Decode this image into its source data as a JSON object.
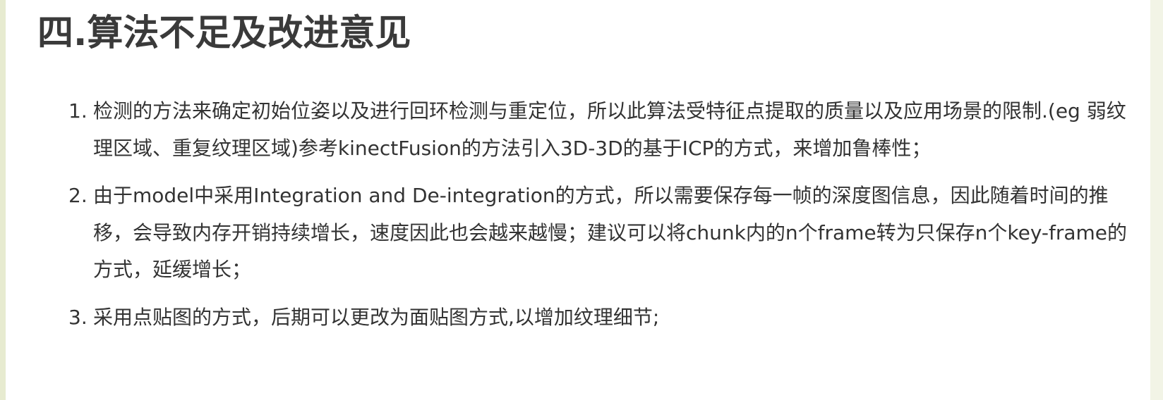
{
  "section": {
    "title": "四.算法不足及改进意见"
  },
  "list": {
    "items": [
      {
        "number": "1.",
        "text": "检测的方法来确定初始位姿以及进行回环检测与重定位，所以此算法受特征点提取的质量以及应用场景的限制.(eg 弱纹理区域、重复纹理区域)参考kinectFusion的方法引入3D-3D的基于ICP的方式，来增加鲁棒性；"
      },
      {
        "number": "2.",
        "text": "由于model中采用Integration and De-integration的方式，所以需要保存每一帧的深度图信息，因此随着时间的推移，会导致内存开销持续增长，速度因此也会越来越慢；建议可以将chunk内的n个frame转为只保存n个key-frame的方式，延缓增长；"
      },
      {
        "number": "3.",
        "text": "采用点贴图的方式，后期可以更改为面贴图方式,以增加纹理细节;"
      }
    ]
  },
  "colors": {
    "page_background": "#ffffff",
    "outer_background": "#eef1de",
    "heading_text": "#3a3a3a",
    "body_text": "#333333"
  }
}
